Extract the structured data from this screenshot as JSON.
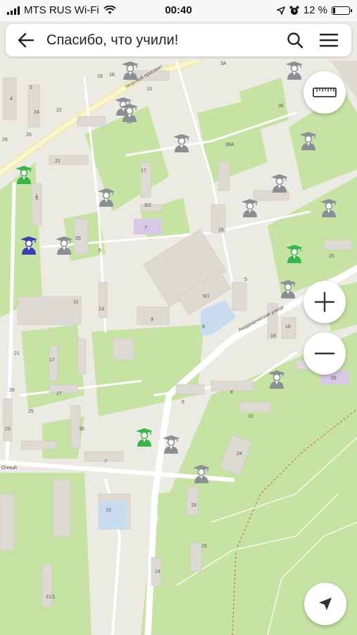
{
  "status_bar": {
    "carrier": "MTS RUS Wi-Fi",
    "time": "00:40",
    "battery_percent": "12 %",
    "battery_level": 0.12
  },
  "header": {
    "title": "Спасибо, что учили!",
    "back_icon": "arrow-left-icon",
    "search_icon": "search-icon",
    "menu_icon": "hamburger-menu-icon"
  },
  "map": {
    "street_labels": [
      "Академическая улица",
      "Морской проспект",
      "Очный"
    ],
    "building_numbers": [
      "3",
      "4",
      "24",
      "22",
      "26",
      "28",
      "18",
      "21",
      "16",
      "13",
      "3А",
      "35",
      "36",
      "36А",
      "9/2",
      "7",
      "17",
      "5",
      "15",
      "3",
      "1",
      "9/1",
      "11",
      "13",
      "8",
      "9",
      "5",
      "17",
      "23",
      "27",
      "25",
      "21",
      "6",
      "8",
      "10",
      "24",
      "18",
      "15",
      "25",
      "19",
      "14",
      "16",
      "7",
      "26",
      "21/1",
      "36",
      "15",
      "25",
      "20",
      "13",
      "10",
      "20"
    ],
    "markers": [
      {
        "icon": "graduate-icon",
        "color": "gray"
      },
      {
        "icon": "graduate-icon",
        "color": "green"
      },
      {
        "icon": "graduate-icon",
        "color": "blue"
      }
    ],
    "colors": {
      "park": "#c6e3a3",
      "ground": "#ecebe3",
      "building": "#dcdad2",
      "road": "#ffffff",
      "marker_gray": "#8a8f94",
      "marker_green": "#39b54a",
      "marker_blue": "#3b3fb5"
    }
  },
  "controls": {
    "ruler_icon": "ruler-icon",
    "zoom_in_icon": "plus-icon",
    "zoom_out_icon": "minus-icon",
    "locate_icon": "navigation-arrow-icon"
  }
}
